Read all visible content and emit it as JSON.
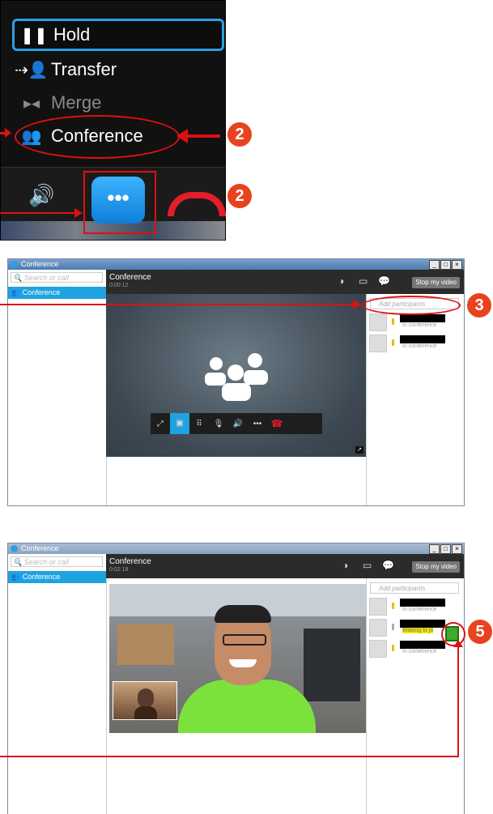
{
  "callMenu": {
    "items": [
      {
        "label": "Hold",
        "icon": "pause-icon"
      },
      {
        "label": "Transfer",
        "icon": "transfer-icon"
      },
      {
        "label": "Merge",
        "icon": "merge-icon"
      },
      {
        "label": "Conference",
        "icon": "conference-icon"
      }
    ],
    "more_label": "•••"
  },
  "callouts": {
    "step2": "2",
    "step3": "3",
    "step5": "5"
  },
  "window1": {
    "title": "Conference",
    "search_placeholder": "Search or call",
    "sidebar_item": "Conference",
    "header_title": "Conference",
    "timer": "0:00:12",
    "stop_video": "Stop my video",
    "add_participants": "Add participants",
    "participants": [
      {
        "status": "In conference"
      },
      {
        "status": "In conference"
      }
    ]
  },
  "window2": {
    "title": "Conference",
    "search_placeholder": "Search or call",
    "sidebar_item": "Conference",
    "header_title": "Conference",
    "timer": "0:02:18",
    "stop_video": "Stop my video",
    "add_participants": "Add participants",
    "participants": [
      {
        "status": "In conference"
      },
      {
        "status": "Waiting to jo"
      },
      {
        "status": "In conference"
      }
    ]
  },
  "colors": {
    "accent": "#1ea3e0",
    "callout": "#e8421f",
    "hangup": "#e31d2b",
    "waiting": "#f3e600"
  }
}
